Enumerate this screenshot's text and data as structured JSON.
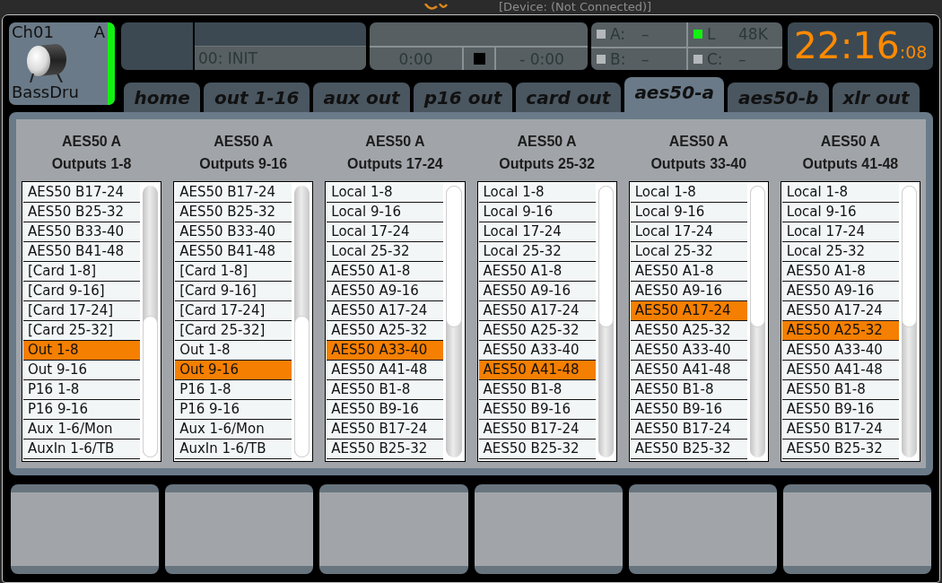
{
  "window": {
    "title": "[Device: (Not Connected)]"
  },
  "channel": {
    "number": "Ch01",
    "bank": "A",
    "name": "BassDru"
  },
  "scene": {
    "name": "00: INIT"
  },
  "transport": {
    "elapsed": "0:00",
    "remaining": "- 0:00"
  },
  "status": [
    {
      "label": "A:",
      "value": "–",
      "on": false
    },
    {
      "label": "L",
      "value": "48K",
      "on": true
    },
    {
      "label": "B:",
      "value": "–",
      "on": false
    },
    {
      "label": "C:",
      "value": "–",
      "on": false
    }
  ],
  "clock": {
    "time": "22:16",
    "seconds": ":08"
  },
  "tabs": [
    {
      "label": "home",
      "selected": false
    },
    {
      "label": "out 1-16",
      "selected": false
    },
    {
      "label": "aux out",
      "selected": false
    },
    {
      "label": "p16 out",
      "selected": false
    },
    {
      "label": "card out",
      "selected": false
    },
    {
      "label": "aes50-a",
      "selected": true
    },
    {
      "label": "aes50-b",
      "selected": false
    },
    {
      "label": "xlr out",
      "selected": false
    }
  ],
  "columns": [
    {
      "title": "AES50 A",
      "subtitle": "Outputs 1-8",
      "scrolled_to_end": true,
      "items": [
        {
          "label": "AES50 B17-24",
          "selected": false
        },
        {
          "label": "AES50 B25-32",
          "selected": false
        },
        {
          "label": "AES50 B33-40",
          "selected": false
        },
        {
          "label": "AES50 B41-48",
          "selected": false
        },
        {
          "label": "[Card 1-8]",
          "selected": false
        },
        {
          "label": "[Card 9-16]",
          "selected": false
        },
        {
          "label": "[Card 17-24]",
          "selected": false
        },
        {
          "label": "[Card 25-32]",
          "selected": false
        },
        {
          "label": "Out 1-8",
          "selected": true
        },
        {
          "label": "Out 9-16",
          "selected": false
        },
        {
          "label": "P16 1-8",
          "selected": false
        },
        {
          "label": "P16 9-16",
          "selected": false
        },
        {
          "label": "Aux 1-6/Mon",
          "selected": false
        },
        {
          "label": "AuxIn 1-6/TB",
          "selected": false
        }
      ]
    },
    {
      "title": "AES50 A",
      "subtitle": "Outputs 9-16",
      "scrolled_to_end": true,
      "items": [
        {
          "label": "AES50 B17-24",
          "selected": false
        },
        {
          "label": "AES50 B25-32",
          "selected": false
        },
        {
          "label": "AES50 B33-40",
          "selected": false
        },
        {
          "label": "AES50 B41-48",
          "selected": false
        },
        {
          "label": "[Card 1-8]",
          "selected": false
        },
        {
          "label": "[Card 9-16]",
          "selected": false
        },
        {
          "label": "[Card 17-24]",
          "selected": false
        },
        {
          "label": "[Card 25-32]",
          "selected": false
        },
        {
          "label": "Out 1-8",
          "selected": false
        },
        {
          "label": "Out 9-16",
          "selected": true
        },
        {
          "label": "P16 1-8",
          "selected": false
        },
        {
          "label": "P16 9-16",
          "selected": false
        },
        {
          "label": "Aux 1-6/Mon",
          "selected": false
        },
        {
          "label": "AuxIn 1-6/TB",
          "selected": false
        }
      ]
    },
    {
      "title": "AES50 A",
      "subtitle": "Outputs 17-24",
      "scrolled_to_end": false,
      "items": [
        {
          "label": "Local 1-8",
          "selected": false
        },
        {
          "label": "Local 9-16",
          "selected": false
        },
        {
          "label": "Local 17-24",
          "selected": false
        },
        {
          "label": "Local 25-32",
          "selected": false
        },
        {
          "label": "AES50 A1-8",
          "selected": false
        },
        {
          "label": "AES50 A9-16",
          "selected": false
        },
        {
          "label": "AES50 A17-24",
          "selected": false
        },
        {
          "label": "AES50 A25-32",
          "selected": false
        },
        {
          "label": "AES50 A33-40",
          "selected": true
        },
        {
          "label": "AES50 A41-48",
          "selected": false
        },
        {
          "label": "AES50 B1-8",
          "selected": false
        },
        {
          "label": "AES50 B9-16",
          "selected": false
        },
        {
          "label": "AES50 B17-24",
          "selected": false
        },
        {
          "label": "AES50 B25-32",
          "selected": false
        }
      ]
    },
    {
      "title": "AES50 A",
      "subtitle": "Outputs 25-32",
      "scrolled_to_end": false,
      "items": [
        {
          "label": "Local 1-8",
          "selected": false
        },
        {
          "label": "Local 9-16",
          "selected": false
        },
        {
          "label": "Local 17-24",
          "selected": false
        },
        {
          "label": "Local 25-32",
          "selected": false
        },
        {
          "label": "AES50 A1-8",
          "selected": false
        },
        {
          "label": "AES50 A9-16",
          "selected": false
        },
        {
          "label": "AES50 A17-24",
          "selected": false
        },
        {
          "label": "AES50 A25-32",
          "selected": false
        },
        {
          "label": "AES50 A33-40",
          "selected": false
        },
        {
          "label": "AES50 A41-48",
          "selected": true
        },
        {
          "label": "AES50 B1-8",
          "selected": false
        },
        {
          "label": "AES50 B9-16",
          "selected": false
        },
        {
          "label": "AES50 B17-24",
          "selected": false
        },
        {
          "label": "AES50 B25-32",
          "selected": false
        }
      ]
    },
    {
      "title": "AES50 A",
      "subtitle": "Outputs 33-40",
      "scrolled_to_end": false,
      "items": [
        {
          "label": "Local 1-8",
          "selected": false
        },
        {
          "label": "Local 9-16",
          "selected": false
        },
        {
          "label": "Local 17-24",
          "selected": false
        },
        {
          "label": "Local 25-32",
          "selected": false
        },
        {
          "label": "AES50 A1-8",
          "selected": false
        },
        {
          "label": "AES50 A9-16",
          "selected": false
        },
        {
          "label": "AES50 A17-24",
          "selected": true
        },
        {
          "label": "AES50 A25-32",
          "selected": false
        },
        {
          "label": "AES50 A33-40",
          "selected": false
        },
        {
          "label": "AES50 A41-48",
          "selected": false
        },
        {
          "label": "AES50 B1-8",
          "selected": false
        },
        {
          "label": "AES50 B9-16",
          "selected": false
        },
        {
          "label": "AES50 B17-24",
          "selected": false
        },
        {
          "label": "AES50 B25-32",
          "selected": false
        }
      ]
    },
    {
      "title": "AES50 A",
      "subtitle": "Outputs 41-48",
      "scrolled_to_end": false,
      "items": [
        {
          "label": "Local 1-8",
          "selected": false
        },
        {
          "label": "Local 9-16",
          "selected": false
        },
        {
          "label": "Local 17-24",
          "selected": false
        },
        {
          "label": "Local 25-32",
          "selected": false
        },
        {
          "label": "AES50 A1-8",
          "selected": false
        },
        {
          "label": "AES50 A9-16",
          "selected": false
        },
        {
          "label": "AES50 A17-24",
          "selected": false
        },
        {
          "label": "AES50 A25-32",
          "selected": true
        },
        {
          "label": "AES50 A33-40",
          "selected": false
        },
        {
          "label": "AES50 A41-48",
          "selected": false
        },
        {
          "label": "AES50 B1-8",
          "selected": false
        },
        {
          "label": "AES50 B9-16",
          "selected": false
        },
        {
          "label": "AES50 B17-24",
          "selected": false
        },
        {
          "label": "AES50 B25-32",
          "selected": false
        }
      ]
    }
  ]
}
